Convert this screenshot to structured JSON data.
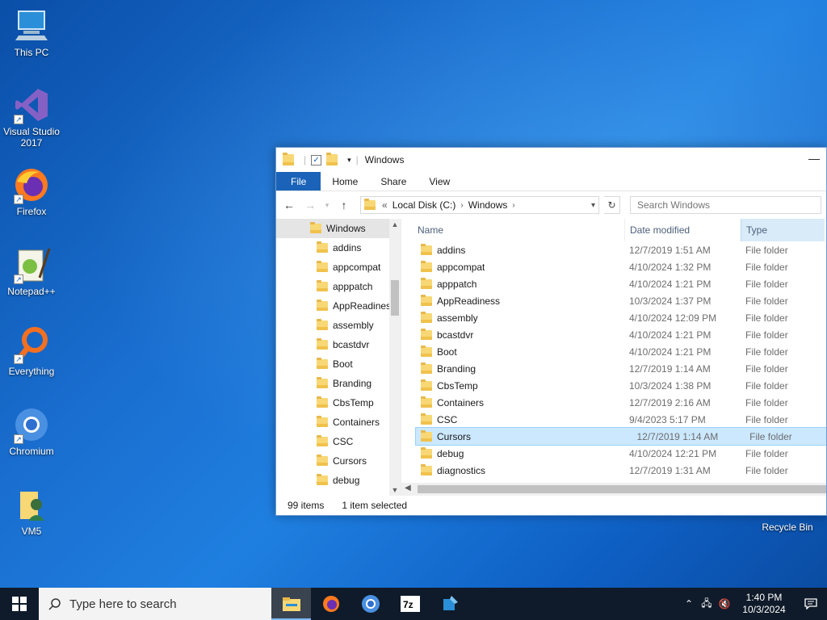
{
  "desktop": {
    "icons": [
      {
        "label": "This PC",
        "icon": "this-pc-icon"
      },
      {
        "label": "Visual Studio 2017",
        "icon": "visual-studio-icon"
      },
      {
        "label": "Firefox",
        "icon": "firefox-icon"
      },
      {
        "label": "Notepad++",
        "icon": "notepadpp-icon"
      },
      {
        "label": "Everything",
        "icon": "everything-icon"
      },
      {
        "label": "Chromium",
        "icon": "chromium-icon"
      },
      {
        "label": "VM5",
        "icon": "user-folder-icon"
      }
    ],
    "recycle_bin": "Recycle Bin"
  },
  "window": {
    "title": "Windows",
    "ribbon_tabs": [
      "File",
      "Home",
      "Share",
      "View"
    ],
    "breadcrumb": {
      "prefix": "«",
      "parts": [
        "Local Disk (C:)",
        "Windows"
      ]
    },
    "search_placeholder": "Search Windows",
    "nav_root": "Windows",
    "nav_items": [
      "addins",
      "appcompat",
      "apppatch",
      "AppReadiness",
      "assembly",
      "bcastdvr",
      "Boot",
      "Branding",
      "CbsTemp",
      "Containers",
      "CSC",
      "Cursors",
      "debug"
    ],
    "columns": {
      "name": "Name",
      "date": "Date modified",
      "type": "Type"
    },
    "rows": [
      {
        "name": "addins",
        "date": "12/7/2019 1:51 AM",
        "type": "File folder"
      },
      {
        "name": "appcompat",
        "date": "4/10/2024 1:32 PM",
        "type": "File folder"
      },
      {
        "name": "apppatch",
        "date": "4/10/2024 1:21 PM",
        "type": "File folder"
      },
      {
        "name": "AppReadiness",
        "date": "10/3/2024 1:37 PM",
        "type": "File folder"
      },
      {
        "name": "assembly",
        "date": "4/10/2024 12:09 PM",
        "type": "File folder"
      },
      {
        "name": "bcastdvr",
        "date": "4/10/2024 1:21 PM",
        "type": "File folder"
      },
      {
        "name": "Boot",
        "date": "4/10/2024 1:21 PM",
        "type": "File folder"
      },
      {
        "name": "Branding",
        "date": "12/7/2019 1:14 AM",
        "type": "File folder"
      },
      {
        "name": "CbsTemp",
        "date": "10/3/2024 1:38 PM",
        "type": "File folder"
      },
      {
        "name": "Containers",
        "date": "12/7/2019 2:16 AM",
        "type": "File folder"
      },
      {
        "name": "CSC",
        "date": "9/4/2023 5:17 PM",
        "type": "File folder"
      },
      {
        "name": "Cursors",
        "date": "12/7/2019 1:14 AM",
        "type": "File folder",
        "selected": true
      },
      {
        "name": "debug",
        "date": "4/10/2024 12:21 PM",
        "type": "File folder"
      },
      {
        "name": "diagnostics",
        "date": "12/7/2019 1:31 AM",
        "type": "File folder"
      }
    ],
    "status": {
      "count": "99 items",
      "selection": "1 item selected"
    }
  },
  "taskbar": {
    "search_placeholder": "Type here to search",
    "apps": [
      "file-explorer-icon",
      "firefox-icon",
      "chromium-icon",
      "7zip-icon",
      "tool-icon"
    ],
    "clock_time": "1:40 PM",
    "clock_date": "10/3/2024"
  },
  "colors": {
    "file_tab": "#1a63b8",
    "selection": "#cce8ff",
    "taskbar": "#0f1b2a"
  }
}
